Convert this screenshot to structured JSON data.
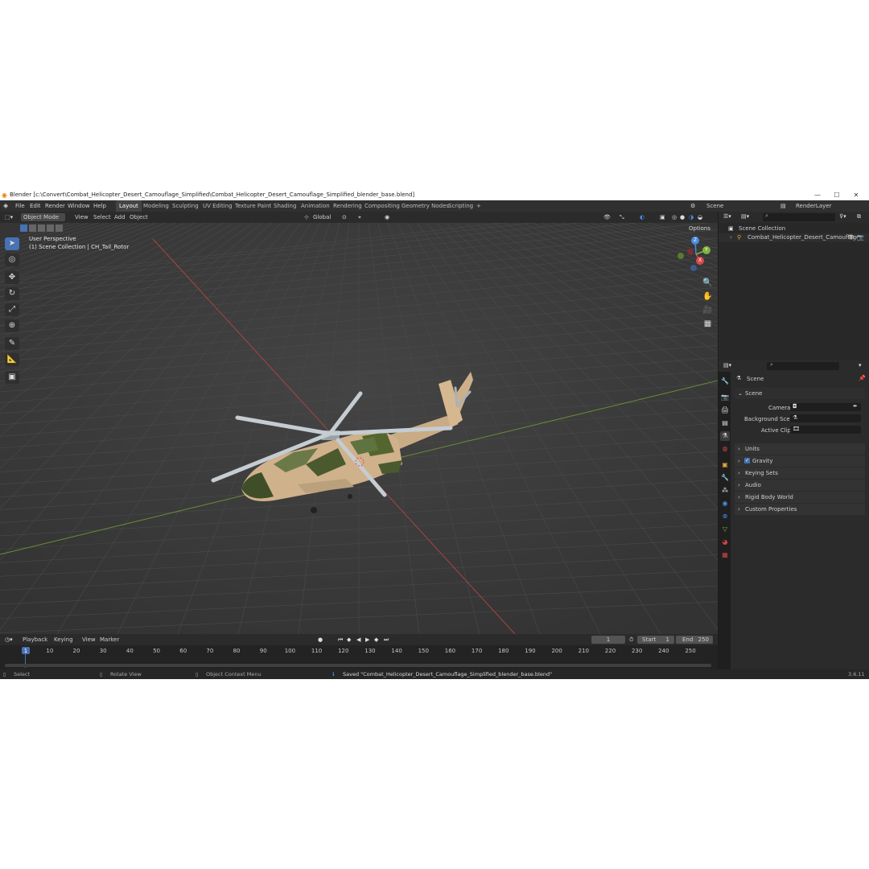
{
  "window": {
    "title": "Blender [c:\\Convert\\Combat_Helicopter_Desert_Camouflage_Simplified\\Combat_Helicopter_Desert_Camouflage_Simplified_blender_base.blend]",
    "minimize": "—",
    "maximize": "☐",
    "close": "✕"
  },
  "menu": {
    "items": [
      "File",
      "Edit",
      "Render",
      "Window",
      "Help"
    ],
    "tabs": [
      "Layout",
      "Modeling",
      "Sculpting",
      "UV Editing",
      "Texture Paint",
      "Shading",
      "Animation",
      "Rendering",
      "Compositing",
      "Geometry Nodes",
      "Scripting"
    ],
    "add_tab": "+",
    "scene": "Scene",
    "view_layer": "RenderLayer"
  },
  "viewport_header": {
    "mode": "Object Mode",
    "menus": [
      "View",
      "Select",
      "Add",
      "Object"
    ],
    "orientation": "Global",
    "options": "Options"
  },
  "viewport": {
    "perspective": "User Perspective",
    "collection_info": "(1) Scene Collection | CH_Tail_Rotor",
    "gizmo": {
      "x": "X",
      "y": "Y",
      "z": "Z"
    }
  },
  "outliner": {
    "root": "Scene Collection",
    "item": "Combat_Helicopter_Desert_Camouflage"
  },
  "properties": {
    "header": "Scene",
    "panel_title": "Scene",
    "camera_label": "Camera",
    "background_scene_label": "Background Scene",
    "active_clip_label": "Active Clip",
    "sections": [
      "Units",
      "Gravity",
      "Keying Sets",
      "Audio",
      "Rigid Body World",
      "Custom Properties"
    ],
    "gravity_checked": true
  },
  "timeline": {
    "menus": [
      "Playback",
      "Keying",
      "View",
      "Marker"
    ],
    "current_frame": "1",
    "start_label": "Start",
    "start": "1",
    "end_label": "End",
    "end": "250",
    "ticks": [
      "1",
      "10",
      "20",
      "30",
      "40",
      "50",
      "60",
      "70",
      "80",
      "90",
      "100",
      "110",
      "120",
      "130",
      "140",
      "150",
      "160",
      "170",
      "180",
      "190",
      "200",
      "210",
      "220",
      "230",
      "240",
      "250"
    ]
  },
  "statusbar": {
    "select": "Select",
    "rotate": "Rotate View",
    "context": "Object Context Menu",
    "message": "Saved \"Combat_Helicopter_Desert_Camouflage_Simplified_blender_base.blend\"",
    "version": "3.6.11"
  },
  "colors": {
    "accent": "#4772b3",
    "x_axis": "#d94a4a",
    "y_axis": "#7fb43a",
    "z_axis": "#4a8be0",
    "helicopter_tan": "#cdb08a",
    "helicopter_green": "#4a5a2e"
  }
}
